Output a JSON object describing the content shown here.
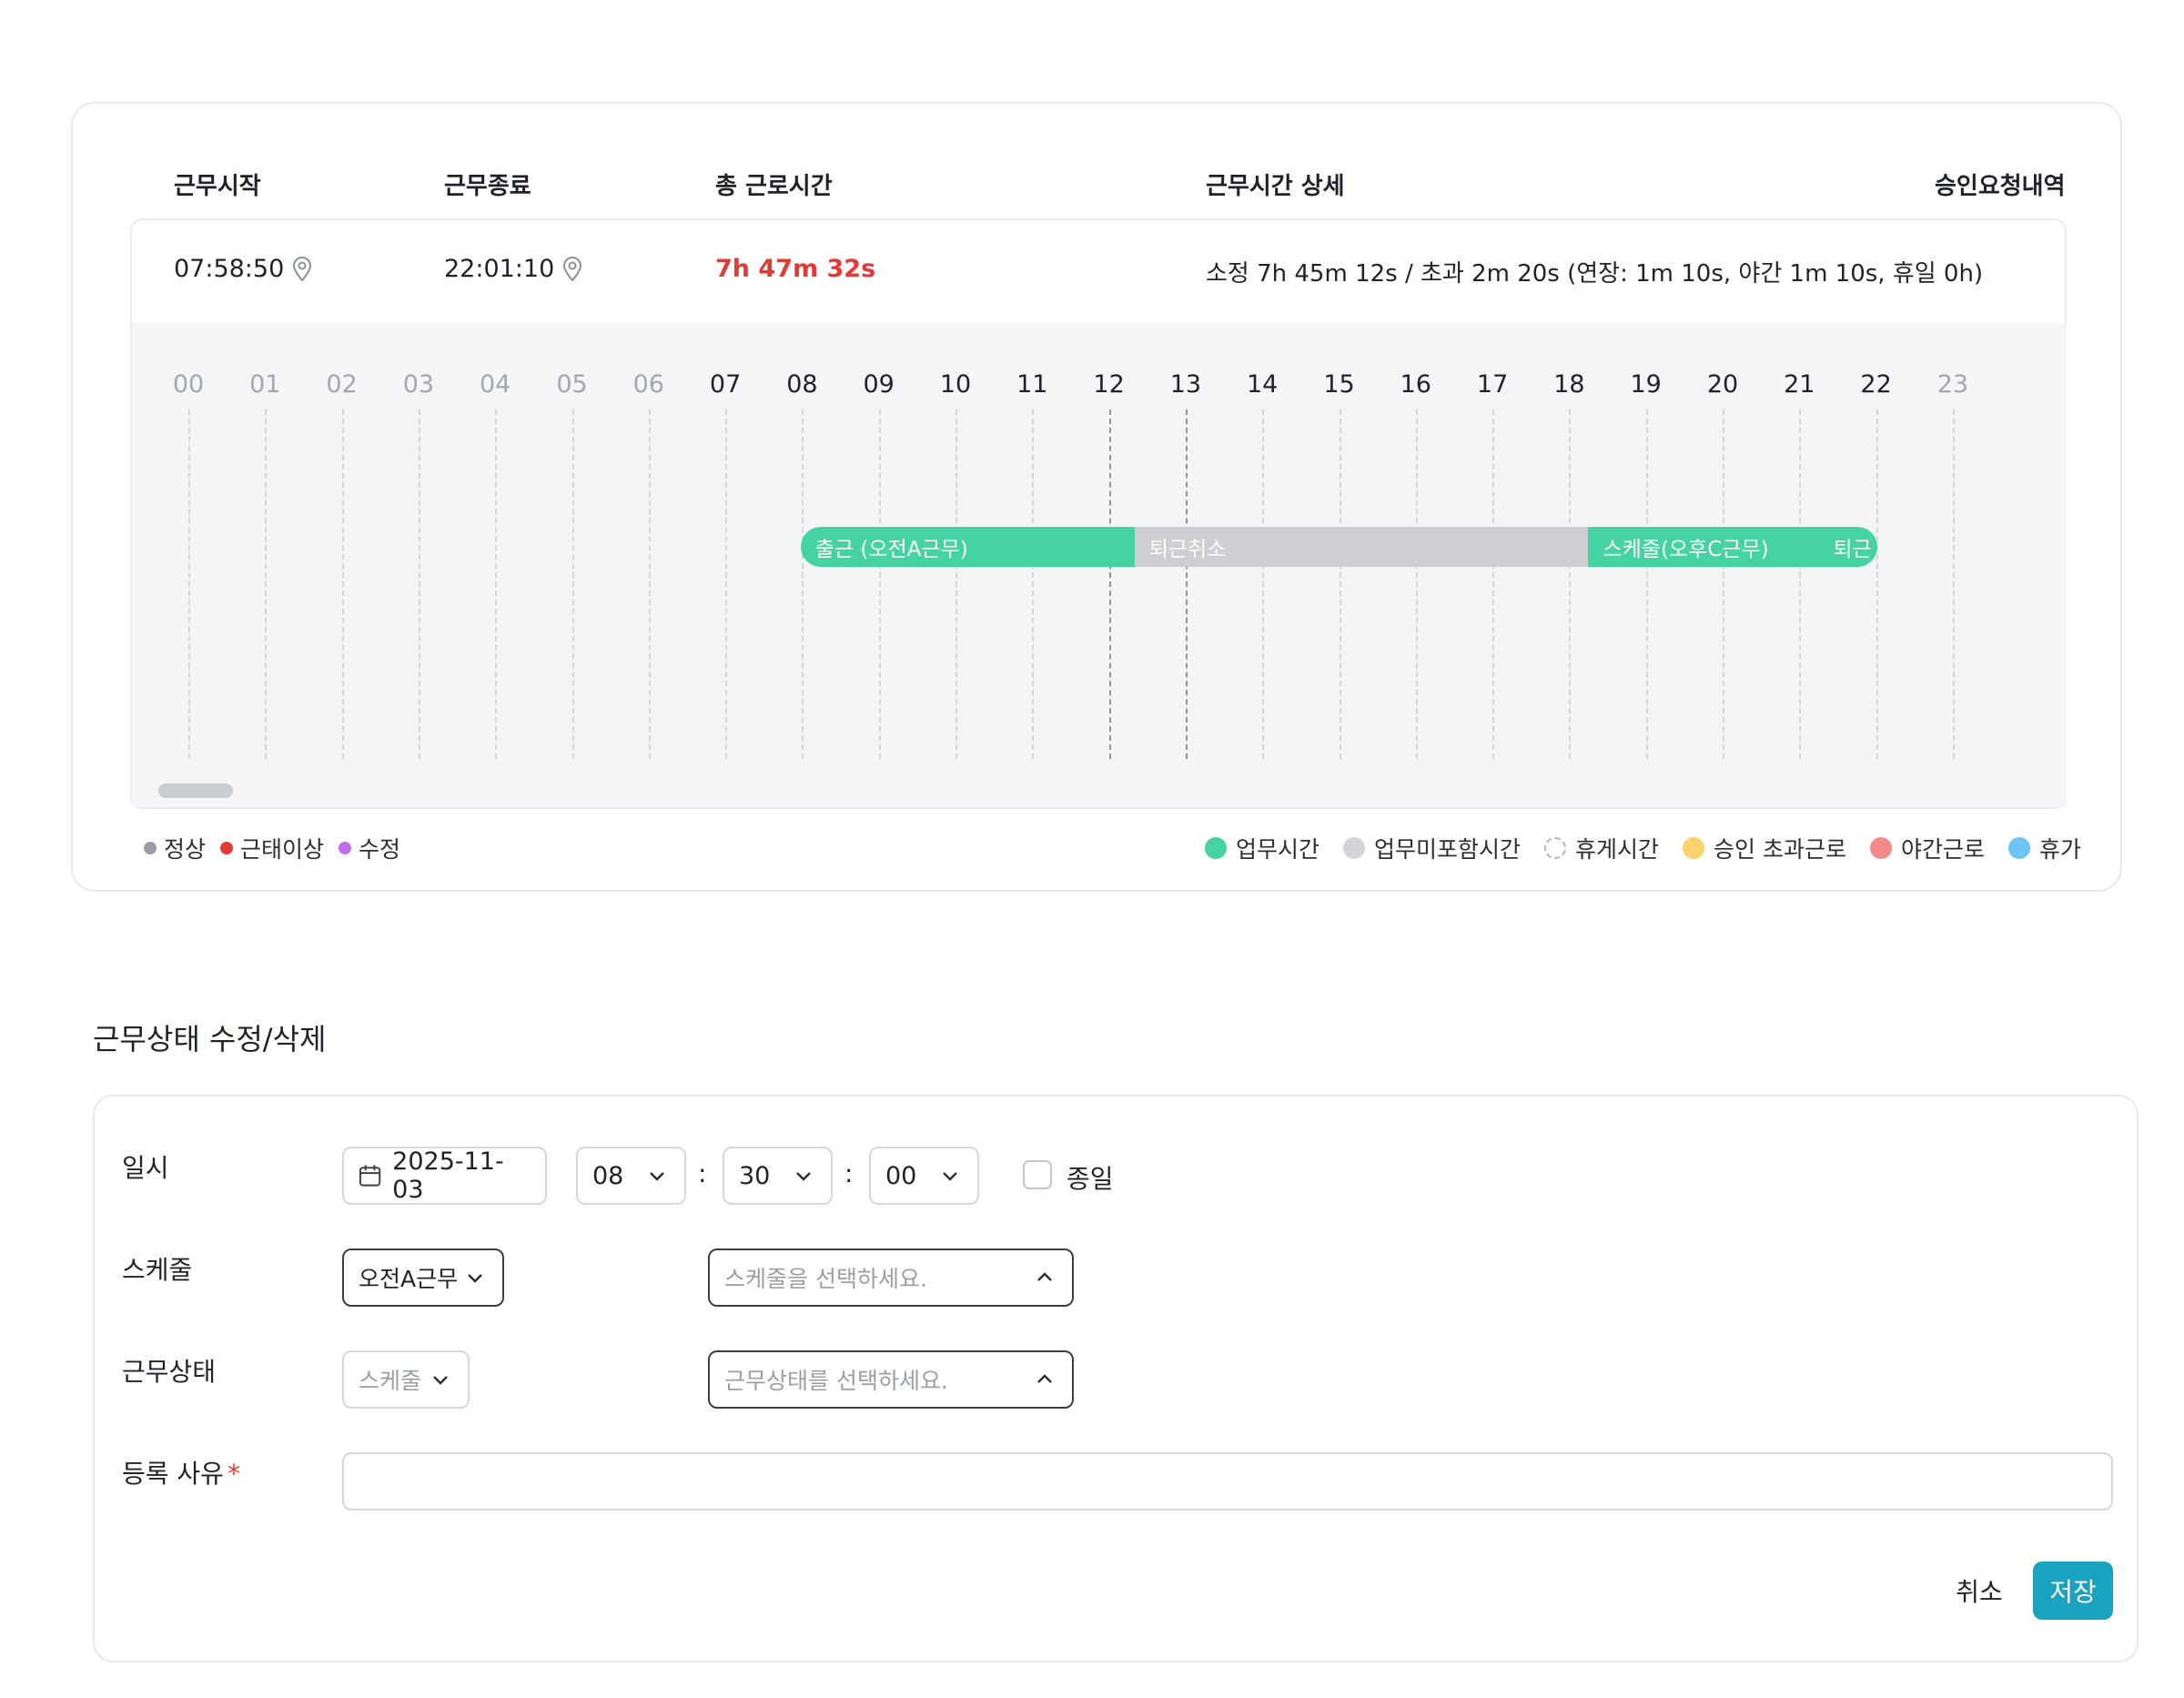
{
  "summary": {
    "headers": {
      "start": "근무시작",
      "end": "근무종료",
      "total": "총 근로시간",
      "detail": "근무시간 상세",
      "approval": "승인요청내역"
    },
    "start_time": "07:58:50",
    "end_time": "22:01:10",
    "total_time": "7h 47m 32s",
    "detail_text": "소정 7h 45m 12s / 초과 2m 20s (연장: 1m 10s, 야간 1m 10s, 휴일 0h)"
  },
  "timeline": {
    "hours": [
      "00",
      "01",
      "02",
      "03",
      "04",
      "05",
      "06",
      "07",
      "08",
      "09",
      "10",
      "11",
      "12",
      "13",
      "14",
      "15",
      "16",
      "17",
      "18",
      "19",
      "20",
      "21",
      "22",
      "23"
    ],
    "active_hours_range": [
      7,
      21
    ],
    "segments": [
      {
        "label": "출근 (오전A근무)",
        "type": "work",
        "color": "#46d3a2",
        "start": "07:58:50",
        "end": "12:20:00"
      },
      {
        "label": "퇴근취소",
        "type": "non-work",
        "color": "#cdcfd3",
        "start": "12:20:00",
        "end": "18:15:00"
      },
      {
        "label": "스케줄(오후C근무)",
        "type": "work",
        "color": "#46d3a2",
        "start": "18:15:00",
        "end": "21:15:00"
      },
      {
        "label": "퇴근",
        "type": "work",
        "color": "#46d3a2",
        "start": "21:15:00",
        "end": "22:01:10"
      }
    ]
  },
  "legend_status": [
    {
      "label": "정상",
      "color": "#9a9ea4"
    },
    {
      "label": "근태이상",
      "color": "#e53935"
    },
    {
      "label": "수정",
      "color": "#c46cf0"
    }
  ],
  "legend_types": [
    {
      "label": "업무시간",
      "color": "#46d3a2",
      "dashed": false
    },
    {
      "label": "업무미포함시간",
      "color": "#d2d4d8",
      "dashed": false
    },
    {
      "label": "휴게시간",
      "color": "transparent",
      "dashed": true
    },
    {
      "label": "승인 초과근로",
      "color": "#fdd16b",
      "dashed": false
    },
    {
      "label": "야간근로",
      "color": "#f4898a",
      "dashed": false
    },
    {
      "label": "휴가",
      "color": "#6cc4f7",
      "dashed": false
    }
  ],
  "form": {
    "section_title": "근무상태 수정/삭제",
    "datetime_label": "일시",
    "date_value": "2025-11-03",
    "hour_value": "08",
    "minute_value": "30",
    "second_value": "00",
    "colon": ":",
    "allday_label": "종일",
    "schedule_label": "스케줄",
    "schedule_value": "오전A근무",
    "schedule_placeholder": "스케줄을 선택하세요.",
    "status_label": "근무상태",
    "status_type_value": "스케줄",
    "status_placeholder": "근무상태를 선택하세요.",
    "reason_label": "등록 사유",
    "required_mark": "*",
    "reason_value": "",
    "cancel_label": "취소",
    "save_label": "저장"
  }
}
